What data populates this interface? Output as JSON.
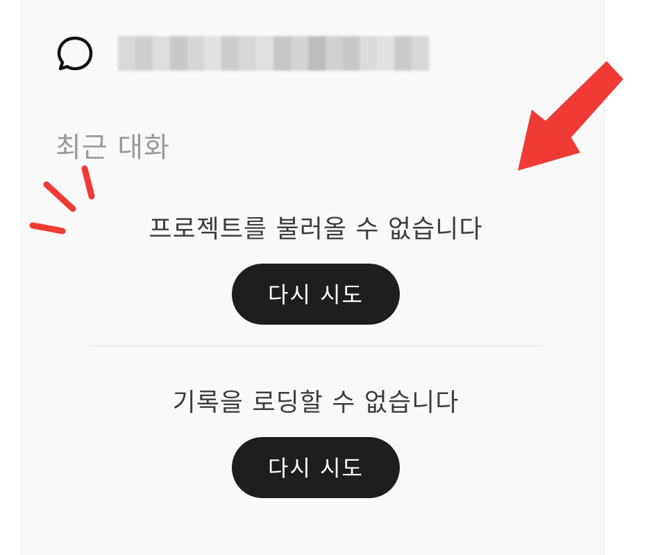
{
  "header": {
    "icon": "chat-bubble-icon",
    "title_redacted": true
  },
  "section": {
    "title": "최근 대화"
  },
  "errors": [
    {
      "message": "프로젝트를 불러올 수 없습니다",
      "button_label": "다시 시도"
    },
    {
      "message": "기록을 로딩할 수 없습니다",
      "button_label": "다시 시도"
    }
  ],
  "annotations": {
    "arrow_color": "#f03a35",
    "emphasis_icon": "emphasis-strokes-icon",
    "arrow_icon": "pointing-arrow-icon"
  }
}
